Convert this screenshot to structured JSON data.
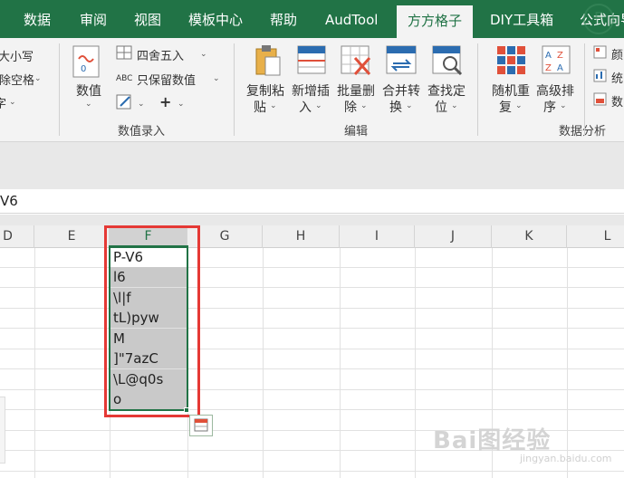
{
  "tabs": [
    "数据",
    "审阅",
    "视图",
    "模板中心",
    "帮助",
    "AudTool",
    "方方格子",
    "DIY工具箱",
    "公式向导"
  ],
  "active_tab": "方方格子",
  "ribbon": {
    "left_partial": [
      "大小写",
      "删除空格",
      "字"
    ],
    "numeric": {
      "value_button": "数值",
      "round_button": "四舍五入",
      "keep_values_button": "只保留数值",
      "plus_label": "+"
    },
    "group_numeric_entry": "数值录入",
    "edit": {
      "copy_paste": [
        "复制粘",
        "贴"
      ],
      "insert": [
        "新增插",
        "入"
      ],
      "batch_delete": [
        "批量删",
        "除"
      ],
      "merge_convert": [
        "合并转",
        "换"
      ],
      "find_locate": [
        "查找定",
        "位"
      ]
    },
    "group_edit": "编辑",
    "analysis": {
      "random_repeat": [
        "随机重",
        "复"
      ],
      "advanced_sort": [
        "高级排",
        "序"
      ]
    },
    "right_partial": [
      "颜",
      "统",
      "数"
    ],
    "group_analysis": "数据分析"
  },
  "formula_bar": {
    "value": "V6"
  },
  "columns": [
    "D",
    "E",
    "F",
    "G",
    "H",
    "I",
    "J",
    "K",
    "L"
  ],
  "selected_column": "F",
  "cells": [
    "P-V6",
    "l6",
    "\\l|f",
    "tL)pyw",
    "M",
    "]\"7azC",
    "\\L@q0s",
    "o"
  ],
  "watermark": {
    "main": "Bai图经验",
    "sub": "jingyan.baidu.com"
  },
  "colors": {
    "excel_green": "#217346",
    "highlight_red": "#e53935",
    "selection_shade": "#c9c9c9"
  }
}
